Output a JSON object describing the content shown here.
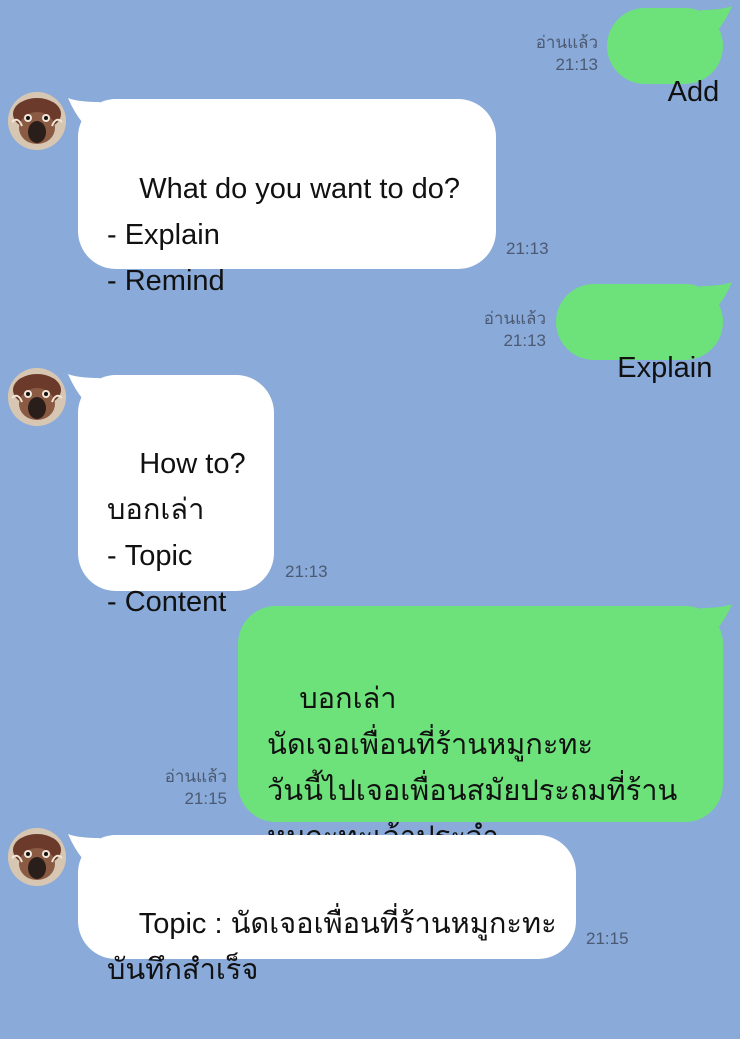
{
  "theme": {
    "background": "#8aaad9",
    "incoming_bubble": "#ffffff",
    "outgoing_bubble": "#6de27a",
    "meta_text": "#4b5a72"
  },
  "messages": [
    {
      "direction": "outgoing",
      "text": "Add",
      "read_label": "อ่านแล้ว",
      "time": "21:13"
    },
    {
      "direction": "incoming",
      "text": "What do you want to do?\n- Explain\n- Remind",
      "time": "21:13",
      "avatar_icon": "bird-avatar-icon"
    },
    {
      "direction": "outgoing",
      "text": "Explain",
      "read_label": "อ่านแล้ว",
      "time": "21:13"
    },
    {
      "direction": "incoming",
      "text": "How to?\nบอกเล่า\n- Topic\n- Content",
      "time": "21:13",
      "avatar_icon": "bird-avatar-icon"
    },
    {
      "direction": "outgoing",
      "text": "บอกเล่า\nนัดเจอเพื่อนที่ร้านหมูกะทะ\nวันนี้ไปเจอเพื่อนสมัยประถมที่ร้าน\nหมูกะทะเจ้าประจำ",
      "read_label": "อ่านแล้ว",
      "time": "21:15"
    },
    {
      "direction": "incoming",
      "text": "Topic : นัดเจอเพื่อนที่ร้านหมูกะทะ\nบันทึกสำเร็จ",
      "time": "21:15",
      "avatar_icon": "bird-avatar-icon"
    }
  ]
}
